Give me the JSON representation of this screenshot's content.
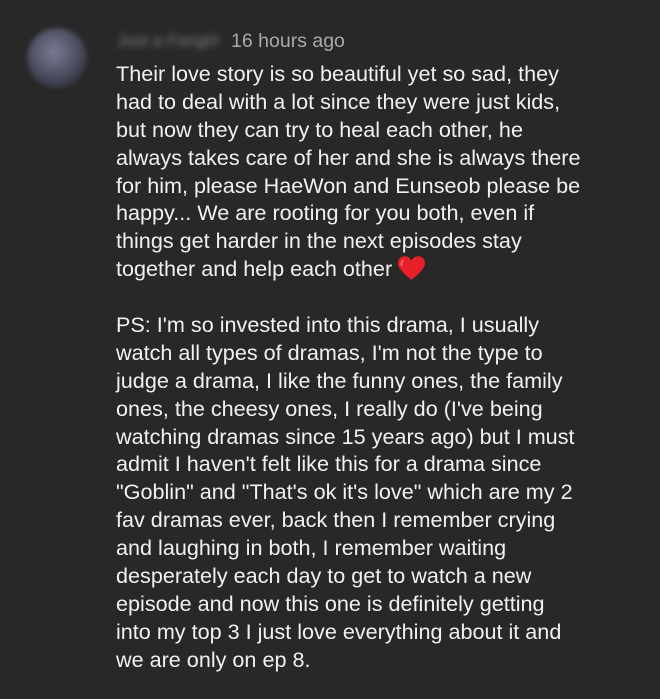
{
  "comment": {
    "author": "Just a Fangirl",
    "timestamp": "16 hours ago",
    "paragraph1_lines": [
      "Their love story is so beautiful yet so sad, they",
      "had to deal with a lot since they were just kids,",
      "but now they can try to heal each other, he",
      "always takes care of her and she is always there",
      "for him, please HaeWon and Eunseob please be",
      "happy... We are rooting for you both, even if",
      "things get harder in the next episodes stay",
      "together and help each other"
    ],
    "emoji": "red-heart",
    "paragraph2_lines": [
      "PS: I'm so invested into this drama, I usually",
      "watch all types of dramas, I'm not the type to",
      "judge a drama, I like the funny ones, the family",
      "ones, the cheesy ones, I really do (I've being",
      "watching dramas since 15 years ago) but I must",
      "admit I haven't felt like this for a drama since",
      "\"Goblin\" and \"That's ok it's love\" which are my 2",
      "fav dramas ever, back then I remember crying",
      "and laughing in both, I remember waiting",
      "desperately each day to get to watch a new",
      "episode and now this one is definitely getting",
      "into my top 3 I just love everything about it and",
      "we are only on ep 8."
    ]
  },
  "colors": {
    "background": "#282828",
    "text": "#f1f1f1",
    "timestamp": "#aaaaaa",
    "heart": "#e8202a"
  }
}
